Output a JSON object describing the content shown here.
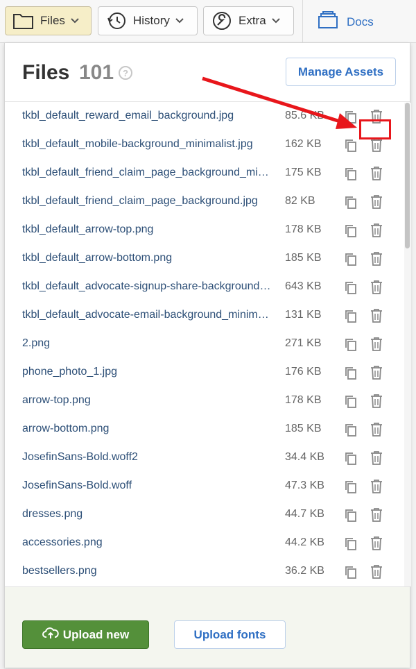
{
  "toolbar": {
    "files_label": "Files",
    "history_label": "History",
    "extra_label": "Extra",
    "docs_label": "Docs"
  },
  "panel": {
    "title": "Files",
    "count": "101",
    "help_symbol": "?",
    "manage_label": "Manage Assets"
  },
  "files": [
    {
      "name": "tkbl_default_reward_email_background.jpg",
      "size": "85.6 KB"
    },
    {
      "name": "tkbl_default_mobile-background_minimalist.jpg",
      "size": "162 KB"
    },
    {
      "name": "tkbl_default_friend_claim_page_background_minimalist.jpg",
      "size": "175 KB"
    },
    {
      "name": "tkbl_default_friend_claim_page_background.jpg",
      "size": "82 KB"
    },
    {
      "name": "tkbl_default_arrow-top.png",
      "size": "178 KB"
    },
    {
      "name": "tkbl_default_arrow-bottom.png",
      "size": "185 KB"
    },
    {
      "name": "tkbl_default_advocate-signup-share-background.jpg",
      "size": "643 KB"
    },
    {
      "name": "tkbl_default_advocate-email-background_minimalist.jpg",
      "size": "131 KB"
    },
    {
      "name": "2.png",
      "size": "271 KB"
    },
    {
      "name": "phone_photo_1.jpg",
      "size": "176 KB"
    },
    {
      "name": "arrow-top.png",
      "size": "178 KB"
    },
    {
      "name": "arrow-bottom.png",
      "size": "185 KB"
    },
    {
      "name": "JosefinSans-Bold.woff2",
      "size": "34.4 KB"
    },
    {
      "name": "JosefinSans-Bold.woff",
      "size": "47.3 KB"
    },
    {
      "name": "dresses.png",
      "size": "44.7 KB"
    },
    {
      "name": "accessories.png",
      "size": "44.2 KB"
    },
    {
      "name": "bestsellers.png",
      "size": "36.2 KB"
    }
  ],
  "footer": {
    "upload_label": "Upload new",
    "upload_fonts_label": "Upload fonts"
  },
  "colors": {
    "accent_blue": "#2f6fc3",
    "upload_green": "#54903a",
    "annotation_red": "#e8161b",
    "file_name": "#2d4f77"
  }
}
